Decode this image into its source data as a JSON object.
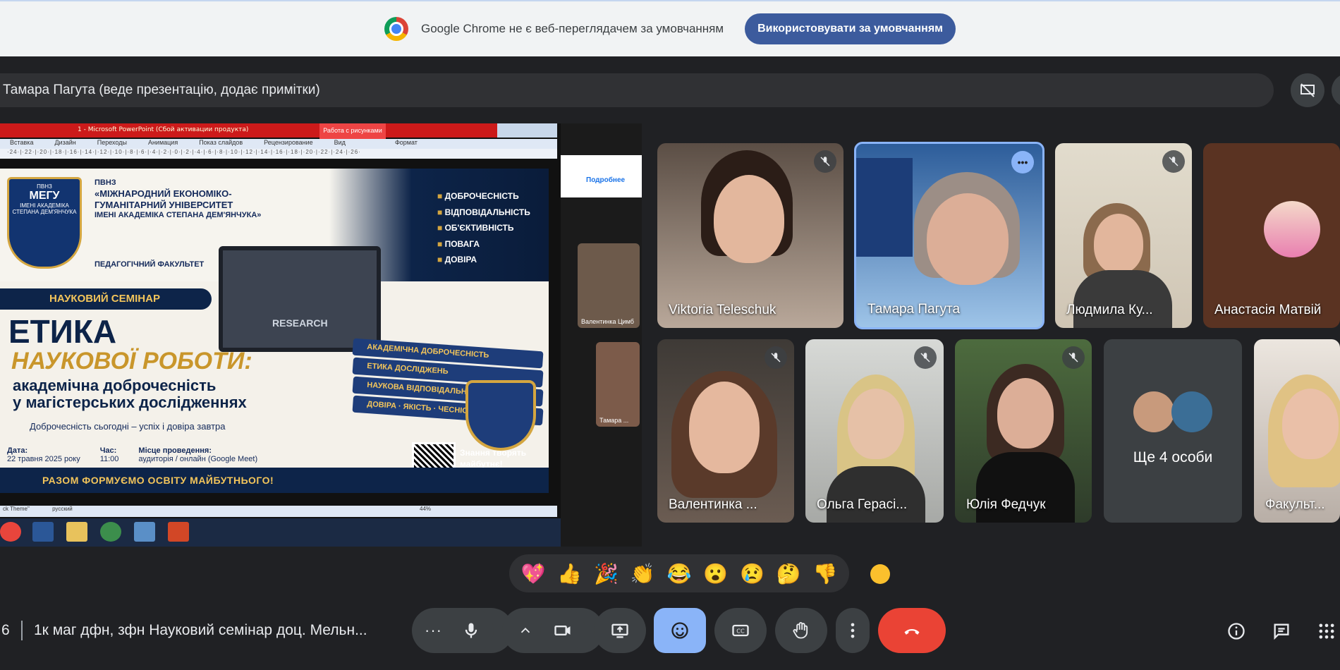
{
  "infobar": {
    "message": "Google Chrome не є веб-переглядачем за умовчанням",
    "button_label": "Використовувати за умовчанням"
  },
  "presenter": {
    "label": "Тамара Пагута (веде презентацію, додає примітки)"
  },
  "presentation": {
    "ppt_title": "1 - Microsoft PowerPoint (Сбой активации продукта)",
    "ppt_extra_tab": "Работа с рисунками",
    "menu": [
      "Вставка",
      "Дизайн",
      "Переходы",
      "Анимация",
      "Показ слайдов",
      "Рецензирование",
      "Вид",
      "Формат"
    ],
    "ruler": "·24·|·22·|·20·|·18·|·16·|·14·|·12·|·10·|·8·|·6·|·4·|·2·|·0·|·2·|·4·|·6·|·8·|·10·|·12·|·14·|·16·|·18·|·20·|·22·|·24·|·26·",
    "status_left": "ck Theme\"",
    "status_lang": "русский",
    "status_zoom": "44%",
    "browser_btn": "Подробнее",
    "mini_tile_1": "Валентинка Цимб",
    "mini_tile_2": "Тамара ..."
  },
  "slide": {
    "crest_top": "ПВНЗ",
    "crest_name": "МЕГУ",
    "crest_sub": "ІМЕНІ АКАДЕМІКА СТЕПАНА ДЕМ'ЯНЧУКА",
    "uni_line1": "ПВНЗ",
    "uni_line2": "«МІЖНАРОДНИЙ ЕКОНОМІКО-ГУМАНІТАРНИЙ УНІВЕРСИТЕТ",
    "uni_line3": "ІМЕНІ АКАДЕМІКА СТЕПАНА ДЕМ'ЯНЧУКА»",
    "faculty": "ПЕДАГОГІЧНИЙ ФАКУЛЬТЕТ",
    "values": [
      "ДОБРОЧЕСНІСТЬ",
      "ВІДПОВІДАЛЬНІСТЬ",
      "ОБ'ЄКТИВНІСТЬ",
      "ПОВАГА",
      "ДОВІРА"
    ],
    "seminar": "НАУКОВИЙ СЕМІНАР",
    "title1": "ЕТИКА",
    "title2": "НАУКОВОЇ РОБОТИ:",
    "title3": "академічна доброчесність",
    "title4": "у магістерських дослідженнях",
    "quote": "Доброчесність сьогодні – успіх і довіра завтра",
    "date_label": "Дата:",
    "date_value": "22 травня 2025 року",
    "time_label": "Час:",
    "time_value": "11:00",
    "place_label": "Місце проведення:",
    "place_value": "аудиторія / онлайн (Google Meet)",
    "laptop_text": "RESEARCH",
    "books": [
      "АКАДЕМІЧНА ДОБРОЧЕСНІСТЬ",
      "ЕТИКА ДОСЛІДЖЕНЬ",
      "НАУКОВА ВІДПОВІДАЛЬНІСТЬ",
      "ДОВІРА · ЯКІСТЬ · ЧЕСНІСТЬ"
    ],
    "qr_text": "Знання творять майбутнє!",
    "footer": "РАЗОМ ФОРМУЄМО ОСВІТУ МАЙБУТНЬОГО!"
  },
  "participants": [
    {
      "name": "Viktoria Teleschuk",
      "muted": true
    },
    {
      "name": "Тамара Пагута",
      "muted": false
    },
    {
      "name": "Людмила Ку...",
      "muted": true
    },
    {
      "name": "Анастасія Матвій",
      "muted": false
    },
    {
      "name": "Валентинка ...",
      "muted": true
    },
    {
      "name": "Ольга Гераci...",
      "muted": true
    },
    {
      "name": "Юлія Федчук",
      "muted": true
    },
    {
      "name": "Ще 4 особи",
      "muted": false
    },
    {
      "name": "Факульт...",
      "muted": false
    }
  ],
  "reactions": [
    "💖",
    "👍",
    "🎉",
    "👏",
    "😂",
    "😮",
    "😢",
    "🤔",
    "👎"
  ],
  "meeting": {
    "time": "6",
    "title": "1к маг дфн, зфн Науковий семінар доц. Мельн..."
  },
  "colors": {
    "meet_bg": "#202124",
    "end_call": "#ea4335",
    "active_control": "#8ab4f8",
    "infobar_button": "#3c5b9d"
  }
}
